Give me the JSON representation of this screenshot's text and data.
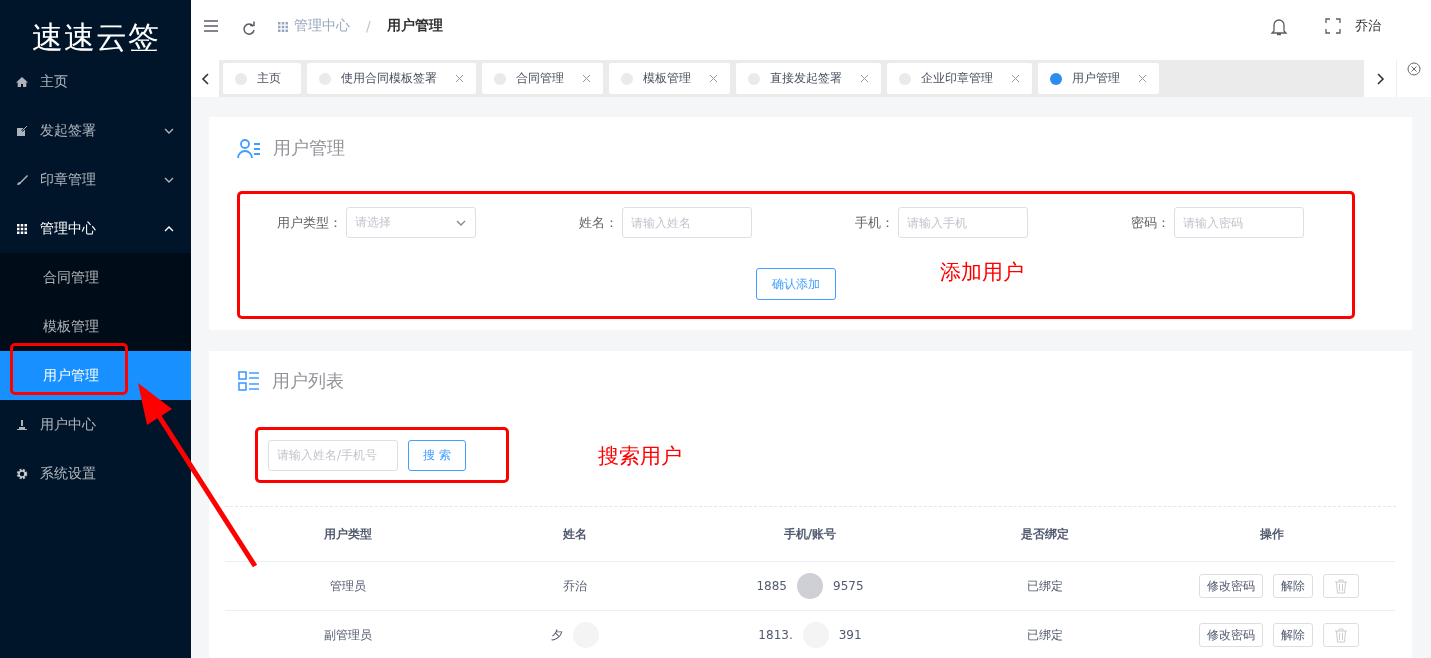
{
  "sidebar": {
    "logo": "速速云签",
    "items": [
      {
        "label": "主页"
      },
      {
        "label": "发起签署",
        "expanded": false
      },
      {
        "label": "印章管理",
        "expanded": false
      },
      {
        "label": "管理中心",
        "expanded": true,
        "children": [
          {
            "label": "合同管理",
            "selected": false
          },
          {
            "label": "模板管理",
            "selected": false
          },
          {
            "label": "用户管理",
            "selected": true
          }
        ]
      },
      {
        "label": "用户中心"
      },
      {
        "label": "系统设置"
      }
    ]
  },
  "header": {
    "breadcrumb": [
      "管理中心",
      "用户管理"
    ],
    "separator": "/",
    "user": "乔治"
  },
  "tabs": [
    {
      "label": "主页",
      "selected": false,
      "closable": false
    },
    {
      "label": "使用合同模板签署",
      "selected": false,
      "closable": true
    },
    {
      "label": "合同管理",
      "selected": false,
      "closable": true
    },
    {
      "label": "模板管理",
      "selected": false,
      "closable": true
    },
    {
      "label": "直接发起签署",
      "selected": false,
      "closable": true
    },
    {
      "label": "企业印章管理",
      "selected": false,
      "closable": true
    },
    {
      "label": "用户管理",
      "selected": true,
      "closable": true
    }
  ],
  "add_user": {
    "title": "用户管理",
    "fields": [
      {
        "label": "用户类型：",
        "kind": "select",
        "placeholder": "请选择"
      },
      {
        "label": "姓名：",
        "kind": "input",
        "placeholder": "请输入姓名"
      },
      {
        "label": "手机：",
        "kind": "input",
        "placeholder": "请输入手机"
      },
      {
        "label": "密码：",
        "kind": "input",
        "placeholder": "请输入密码"
      }
    ],
    "button": "确认添加",
    "annotation": "添加用户"
  },
  "user_list": {
    "title": "用户列表",
    "search": {
      "placeholder": "请输入姓名/手机号",
      "button": "搜 索"
    },
    "annotation": "搜索用户",
    "columns": [
      "用户类型",
      "姓名",
      "手机/账号",
      "是否绑定",
      "操作"
    ],
    "rows": [
      {
        "type": "管理员",
        "name": "乔治",
        "phone": [
          "1885",
          "9575"
        ],
        "bound": "已绑定",
        "actions": [
          "修改密码",
          "解除"
        ]
      },
      {
        "type": "副管理员",
        "name": "夕",
        "phone": [
          "1813.",
          "391"
        ],
        "bound": "已绑定",
        "actions": [
          "修改密码",
          "解除"
        ]
      }
    ]
  }
}
